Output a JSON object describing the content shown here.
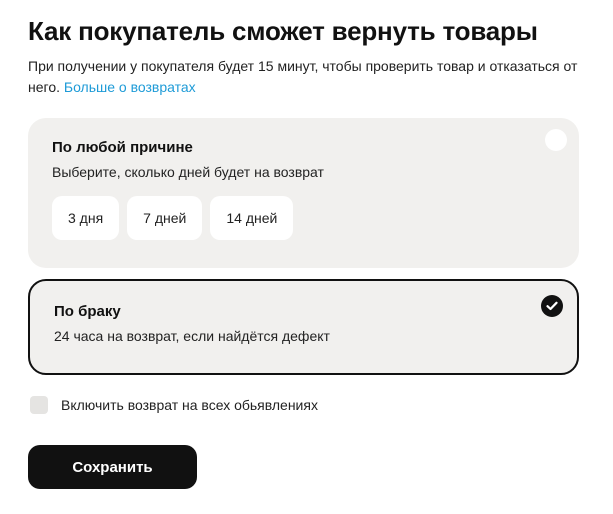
{
  "header": {
    "title": "Как покупатель сможет вернуть товары",
    "description": "При получении у покупателя будет 15 минут, чтобы проверить товар и отказаться от него.",
    "link_label": "Больше о возвратах"
  },
  "options": {
    "any_reason": {
      "title": "По любой причине",
      "subtitle": "Выберите, сколько дней будет на возврат",
      "selected": false,
      "days": [
        "3 дня",
        "7 дней",
        "14 дней"
      ]
    },
    "defect": {
      "title": "По браку",
      "subtitle": "24 часа на возврат, если найдётся дефект",
      "selected": true
    }
  },
  "all_listings_checkbox": {
    "label": "Включить возврат на всех обьявлениях",
    "checked": false
  },
  "save_button": {
    "label": "Сохранить"
  },
  "colors": {
    "accent_link": "#1e9bd7",
    "card_bg": "#f1f0ee",
    "primary": "#111111"
  }
}
